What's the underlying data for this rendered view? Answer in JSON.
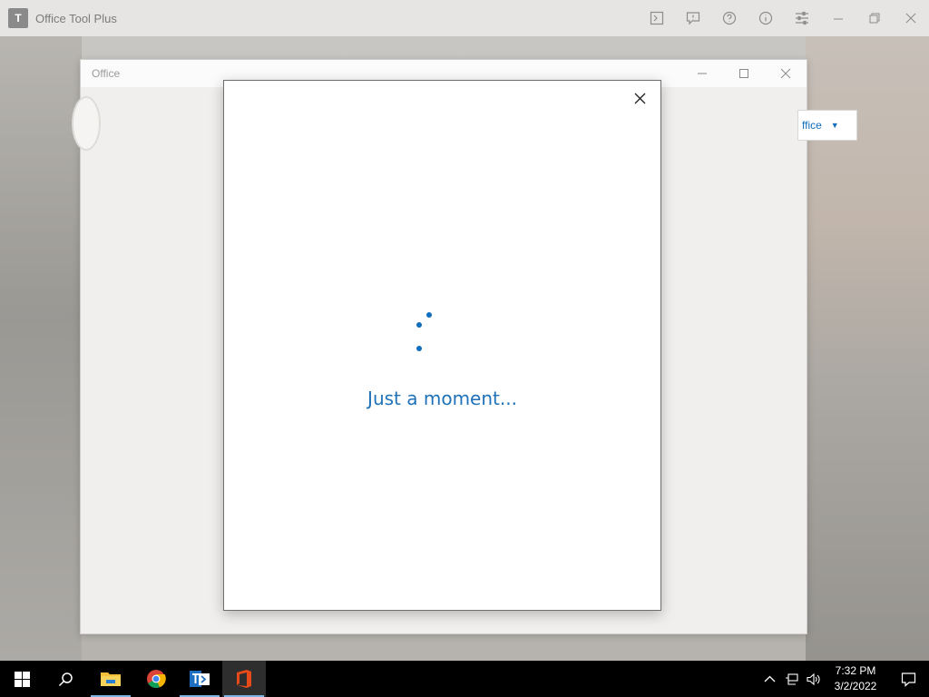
{
  "app": {
    "title": "Office Tool Plus",
    "logo_text": "T",
    "toolbar_icons": [
      "terminal-icon",
      "feedback-icon",
      "help-icon",
      "info-icon",
      "settings-sliders-icon",
      "minimize-icon",
      "restore-icon",
      "close-icon"
    ]
  },
  "office_window": {
    "title": "Office",
    "dropdown_label": "ffice"
  },
  "dialog": {
    "loading_text": "Just a moment...",
    "accent_color": "#106ebe"
  },
  "taskbar": {
    "apps": [
      "start-icon",
      "search-icon",
      "file-explorer-icon",
      "chrome-icon",
      "office-tool-plus-icon",
      "office-icon"
    ],
    "time": "7:32 PM",
    "date": "3/2/2022"
  }
}
